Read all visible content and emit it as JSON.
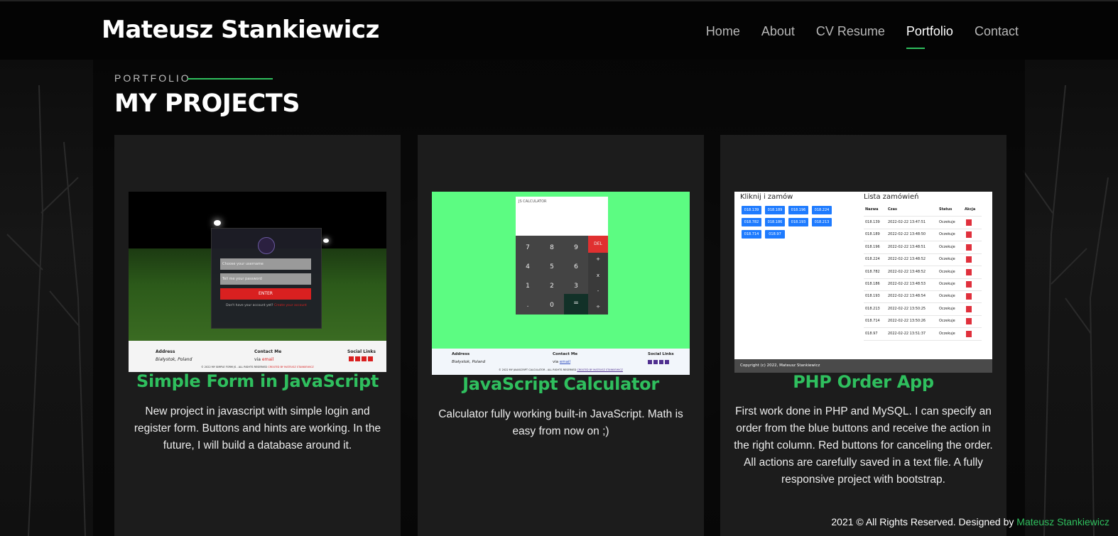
{
  "header": {
    "brand": "Mateusz Stankiewicz",
    "nav": [
      {
        "label": "Home",
        "active": false
      },
      {
        "label": "About",
        "active": false
      },
      {
        "label": "CV Resume",
        "active": false
      },
      {
        "label": "Portfolio",
        "active": true
      },
      {
        "label": "Contact",
        "active": false
      }
    ]
  },
  "section": {
    "kicker": "PORTFOLIO",
    "title": "MY PROJECTS"
  },
  "projects": [
    {
      "title": "Simple Form in JavaScript",
      "description": "New project in javascript with simple login and register form. Buttons and hints are working. In the future, I will build a database around it.",
      "thumb": {
        "username_placeholder": "Choose your username",
        "password_placeholder": "Tell me your password",
        "button": "ENTER",
        "hint": "Don't have your account yet?",
        "hint_link": "Create your account",
        "address_label": "Address",
        "address_value": "Białystok, Poland",
        "contact_label": "Contact Me",
        "contact_via": "via",
        "contact_link": "email",
        "social_label": "Social Links",
        "copyright": "© 2022 MY SIMPLE FORM JS - ALL RIGHTS RESERVED",
        "created_by": "CREATED BY MATEUSZ STANKIEWICZ"
      }
    },
    {
      "title": "JavaScript Calculator",
      "description": "Calculator fully working built-in JavaScript. Math is easy from now on ;)",
      "thumb": {
        "display_label": "JS CALCULATOR",
        "keys": [
          "7",
          "8",
          "9",
          "DEL",
          "4",
          "5",
          "6",
          "+",
          "1",
          "2",
          "3",
          "x",
          ".",
          "0",
          "=",
          "-",
          "÷"
        ],
        "address_label": "Address",
        "address_value": "Białystok, Poland",
        "contact_label": "Contact Me",
        "contact_via": "via",
        "contact_link": "email",
        "social_label": "Social Links",
        "copyright": "© 2022 MY JAVASCRIPT CALCULATOR - ALL RIGHTS RESERVED",
        "created_by": "CREATED BY MATEUSZ STANKIEWICZ"
      }
    },
    {
      "title": "PHP Order App",
      "description": "First work done in PHP and MySQL. I can specify an order from the blue buttons and receive the action in the right column. Red buttons for canceling the order. All actions are carefully saved in a text file. A fully responsive project with bootstrap.",
      "thumb": {
        "left_title": "Kliknij i zamów",
        "right_title": "Lista zamówień",
        "buttons": [
          "018.139",
          "018.189",
          "018.196",
          "018.224",
          "018.782",
          "018.186",
          "018.193",
          "018.213",
          "018.714",
          "018.97"
        ],
        "columns": [
          "Nazwa",
          "Czas",
          "Status",
          "Akcja"
        ],
        "rows": [
          [
            "018.139",
            "2022-02-22 13:47:51",
            "Oczekuje"
          ],
          [
            "018.189",
            "2022-02-22 13:48:50",
            "Oczekuje"
          ],
          [
            "018.196",
            "2022-02-22 13:48:51",
            "Oczekuje"
          ],
          [
            "018.224",
            "2022-02-22 13:48:52",
            "Oczekuje"
          ],
          [
            "018.782",
            "2022-02-22 13:48:52",
            "Oczekuje"
          ],
          [
            "018.186",
            "2022-02-22 13:48:53",
            "Oczekuje"
          ],
          [
            "018.193",
            "2022-02-22 13:48:54",
            "Oczekuje"
          ],
          [
            "018.213",
            "2022-02-22 13:50:25",
            "Oczekuje"
          ],
          [
            "018.714",
            "2022-02-22 13:50:26",
            "Oczekuje"
          ],
          [
            "018.97",
            "2022-02-22 13:51:37",
            "Oczekuje"
          ]
        ],
        "footer": "Copyright (c) 2022, Mateusz Stankiewicz"
      }
    }
  ],
  "footer": {
    "text": "2021 © All Rights Reserved. Designed by",
    "author": "Mateusz Stankiewicz"
  },
  "colors": {
    "accent": "#2fbf5e",
    "calculator_bg": "#5cfc82",
    "card_bg": "#1c1c1c",
    "php_button": "#1e7bff",
    "php_cancel": "#e0303c"
  }
}
